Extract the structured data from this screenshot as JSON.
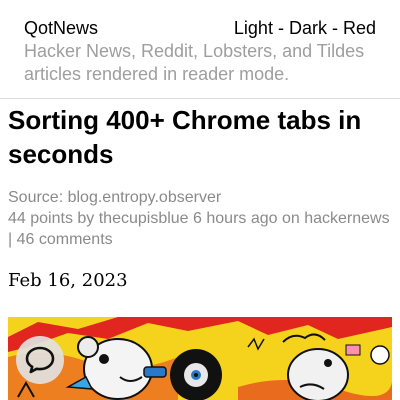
{
  "header": {
    "brand": "QotNews",
    "themes": {
      "light": "Light",
      "separator": " - ",
      "dark": "Dark",
      "red": "Red"
    },
    "tagline": "Hacker News, Reddit, Lobsters, and Tildes articles rendered in reader mode."
  },
  "article": {
    "title": "Sorting 400+ Chrome tabs in seconds",
    "source_prefix": "Source: ",
    "source": "blog.entropy.observer",
    "points": "44 points",
    "by": " by ",
    "author": "thecupisblue",
    "time": " 6 hours ago",
    "on": " on ",
    "site": "hackernews",
    "pipe": " | ",
    "comments": "46 comments",
    "date": "Feb 16, 2023"
  },
  "colors": {
    "muted_text": "#9e9e9e",
    "hero_background": "#f5d31c",
    "accent_red": "#e0261f"
  },
  "icons": {
    "chat": "chat-bubble-icon"
  }
}
